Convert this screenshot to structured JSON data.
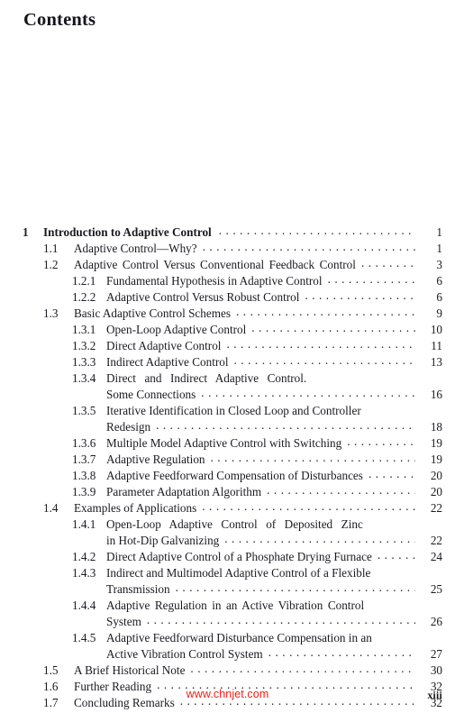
{
  "page": {
    "title": "Contents",
    "folio": "xiii",
    "watermark": "www.chnjet.com",
    "watermark_color": "#ee2015"
  },
  "toc": {
    "entries": [
      {
        "level": "chapter",
        "number": "1",
        "label": "Introduction to Adaptive Control",
        "page": "1"
      },
      {
        "level": "section",
        "number": "1.1",
        "label": "Adaptive Control—Why?",
        "page": "1"
      },
      {
        "level": "section",
        "number": "1.2",
        "label": "Adaptive Control Versus Conventional Feedback Control",
        "page": "3"
      },
      {
        "level": "sub",
        "number": "1.2.1",
        "label": "Fundamental Hypothesis in Adaptive Control",
        "page": "6"
      },
      {
        "level": "sub",
        "number": "1.2.2",
        "label": "Adaptive Control Versus Robust Control",
        "page": "6"
      },
      {
        "level": "section",
        "number": "1.3",
        "label": "Basic Adaptive Control Schemes",
        "page": "9"
      },
      {
        "level": "sub",
        "number": "1.3.1",
        "label": "Open-Loop Adaptive Control",
        "page": "10"
      },
      {
        "level": "sub",
        "number": "1.3.2",
        "label": "Direct Adaptive Control",
        "page": "11"
      },
      {
        "level": "sub",
        "number": "1.3.3",
        "label": "Indirect Adaptive Control",
        "page": "13"
      },
      {
        "level": "sub",
        "number": "1.3.4",
        "label": "Direct and Indirect Adaptive Control.",
        "label2": "Some Connections",
        "page": "16"
      },
      {
        "level": "sub",
        "number": "1.3.5",
        "label": "Iterative Identification in Closed Loop and Controller",
        "label2": "Redesign",
        "page": "18"
      },
      {
        "level": "sub",
        "number": "1.3.6",
        "label": "Multiple Model Adaptive Control with Switching",
        "page": "19"
      },
      {
        "level": "sub",
        "number": "1.3.7",
        "label": "Adaptive Regulation",
        "page": "19"
      },
      {
        "level": "sub",
        "number": "1.3.8",
        "label": "Adaptive Feedforward Compensation of Disturbances",
        "page": "20"
      },
      {
        "level": "sub",
        "number": "1.3.9",
        "label": "Parameter Adaptation Algorithm",
        "page": "20"
      },
      {
        "level": "section",
        "number": "1.4",
        "label": "Examples of Applications",
        "page": "22"
      },
      {
        "level": "sub",
        "number": "1.4.1",
        "label": "Open-Loop Adaptive Control of Deposited Zinc",
        "label2": "in Hot-Dip Galvanizing",
        "page": "22"
      },
      {
        "level": "sub",
        "number": "1.4.2",
        "label": "Direct Adaptive Control of a Phosphate Drying Furnace",
        "page": "24"
      },
      {
        "level": "sub",
        "number": "1.4.3",
        "label": "Indirect and Multimodel Adaptive Control of a Flexible",
        "label2": "Transmission",
        "page": "25"
      },
      {
        "level": "sub",
        "number": "1.4.4",
        "label": "Adaptive Regulation in an Active Vibration Control",
        "label2": "System",
        "page": "26"
      },
      {
        "level": "sub",
        "number": "1.4.5",
        "label": "Adaptive Feedforward Disturbance Compensation in an",
        "label2": "Active Vibration Control System",
        "page": "27"
      },
      {
        "level": "section",
        "number": "1.5",
        "label": "A Brief Historical Note",
        "page": "30"
      },
      {
        "level": "section",
        "number": "1.6",
        "label": "Further Reading",
        "page": "32"
      },
      {
        "level": "section",
        "number": "1.7",
        "label": "Concluding Remarks",
        "page": "32"
      }
    ]
  }
}
